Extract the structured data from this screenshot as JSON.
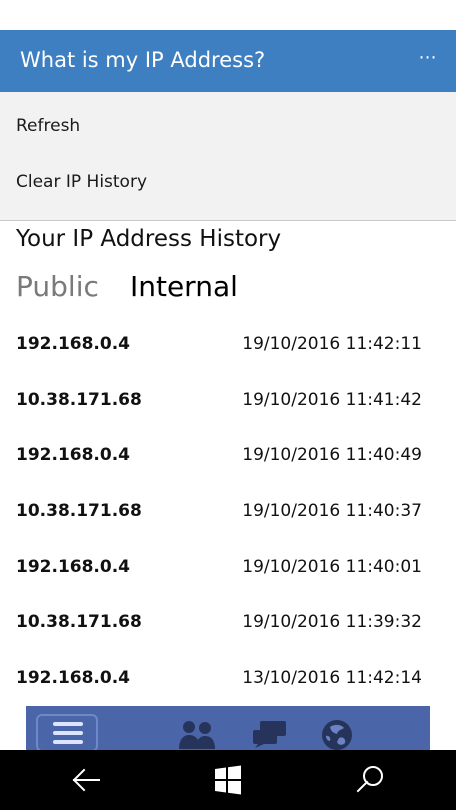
{
  "app": {
    "title": "What is my IP Address?",
    "more_label": "⋯"
  },
  "menu": {
    "items": [
      {
        "label": "Refresh"
      },
      {
        "label": "Clear IP History"
      }
    ]
  },
  "history": {
    "title": "Your IP Address History",
    "tabs": [
      {
        "label": "Public",
        "selected": false
      },
      {
        "label": "Internal",
        "selected": true
      }
    ],
    "rows": [
      {
        "ip": "192.168.0.4",
        "timestamp": "19/10/2016 11:42:11"
      },
      {
        "ip": "10.38.171.68",
        "timestamp": "19/10/2016 11:41:42"
      },
      {
        "ip": "192.168.0.4",
        "timestamp": "19/10/2016 11:40:49"
      },
      {
        "ip": "10.38.171.68",
        "timestamp": "19/10/2016 11:40:37"
      },
      {
        "ip": "192.168.0.4",
        "timestamp": "19/10/2016 11:40:01"
      },
      {
        "ip": "10.38.171.68",
        "timestamp": "19/10/2016 11:39:32"
      },
      {
        "ip": "192.168.0.4",
        "timestamp": "13/10/2016 11:42:14"
      }
    ]
  },
  "partial_bar": {
    "icons": [
      "menu-icon",
      "friends-icon",
      "chat-icon",
      "globe-icon"
    ]
  },
  "system_nav": {
    "icons": [
      "back-arrow-icon",
      "windows-start-icon",
      "search-icon"
    ]
  },
  "colors": {
    "header": "#3d7fc1",
    "menu_background": "#f2f2f2",
    "nav_bar": "#000000",
    "partial_bar": "#4a66a8"
  }
}
